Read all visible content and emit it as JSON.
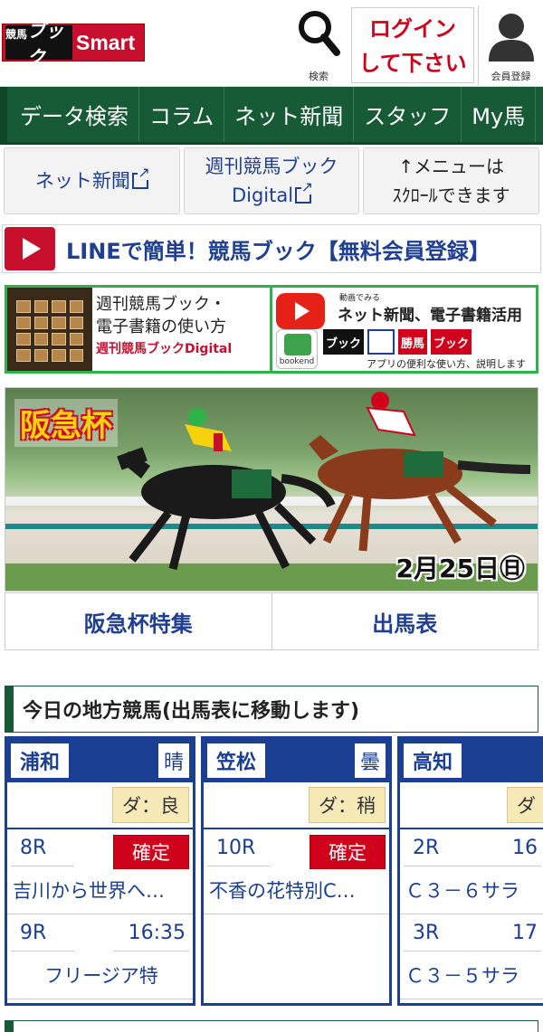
{
  "header": {
    "logo_text": "Smart",
    "logo_mark": "競馬",
    "logo_book": "ブック",
    "search_label": "検索",
    "login_line1": "ログイン",
    "login_line2": "して下さい",
    "member_label": "会員登録"
  },
  "nav": {
    "items": [
      "データ検索",
      "コラム",
      "ネット新聞",
      "スタッフ",
      "My馬"
    ]
  },
  "links": {
    "net_paper": "ネット新聞",
    "weekly_line1": "週刊競馬ブック",
    "weekly_line2": "Digital",
    "note_line1": "↑メニューは",
    "note_line2": "ｽｸﾛｰﾙできます"
  },
  "line_banner": {
    "text": "LINEで簡単！競馬ブック【無料会員登録】"
  },
  "promo1": {
    "line1": "週刊競馬ブック・",
    "line2": "電子書籍の使い方",
    "line3": "週刊競馬ブックDigital"
  },
  "promo2": {
    "small": "動画でみる",
    "title": "ネット新聞、電子書籍活用",
    "bookend": "bookend",
    "app1": "ブック",
    "app2": "",
    "app3": "勝馬",
    "app4": "ブック",
    "footer": "アプリの便利な使い方、説明します"
  },
  "hero": {
    "title": "阪急杯",
    "date": "2月25日㊐"
  },
  "feature": {
    "tab1": "阪急杯特集",
    "tab2": "出馬表"
  },
  "local": {
    "heading": "今日の地方競馬(出馬表に移動します)",
    "tracks": [
      {
        "name": "浦和",
        "weather": "晴",
        "condition": "ダ：良",
        "races": [
          {
            "no": "8R",
            "status": "確定",
            "time": "",
            "name": "吉川から世界へ…"
          },
          {
            "no": "9R",
            "status": "",
            "time": "16:35",
            "name": "フリージア特"
          }
        ]
      },
      {
        "name": "笠松",
        "weather": "曇",
        "condition": "ダ：稍",
        "races": [
          {
            "no": "10R",
            "status": "確定",
            "time": "",
            "name": "不香の花特別C…"
          }
        ]
      },
      {
        "name": "高知",
        "weather": "",
        "condition": "ダ",
        "races": [
          {
            "no": "2R",
            "status": "",
            "time": "16",
            "name": "Ｃ３－６サラ"
          },
          {
            "no": "3R",
            "status": "",
            "time": "17",
            "name": "Ｃ３－５サラ"
          }
        ]
      }
    ]
  },
  "colors": {
    "brand_red": "#c8102e",
    "nav_green": "#175a36",
    "link_blue": "#1f3f93",
    "track_blue": "#1a3f93",
    "status_red": "#d0021b",
    "condition_bg": "#f5e9b8"
  }
}
